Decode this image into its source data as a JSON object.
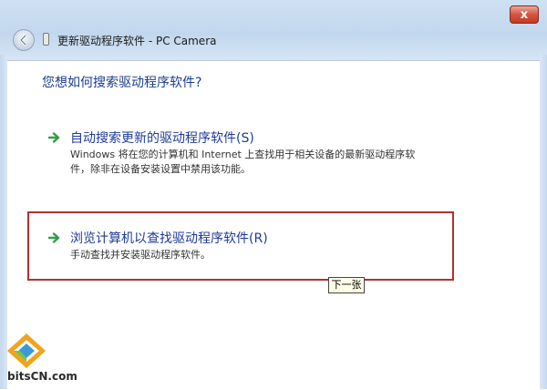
{
  "window": {
    "title": "更新驱动程序软件 - PC Camera",
    "close_label": "x"
  },
  "wizard": {
    "question": "您想如何搜索驱动程序软件?",
    "options": [
      {
        "title": "自动搜索更新的驱动程序软件(S)",
        "desc_line1": "Windows 将在您的计算机和 Internet 上查找用于相关设备的最新驱动程序软",
        "desc_line2": "件，除非在设备安装设置中禁用该功能。"
      },
      {
        "title": "浏览计算机以查找驱动程序软件(R)",
        "desc_line1": "手动查找并安装驱动程序软件。"
      }
    ]
  },
  "annotation": {
    "tooltip": "下一张"
  },
  "watermark": {
    "text": "bitsCN.com"
  },
  "colors": {
    "accent_link": "#1e3b9a",
    "arrow_green": "#2ea043",
    "highlight_red": "#b03030",
    "close_red": "#c23a25"
  },
  "icons": [
    "back-arrow-icon",
    "device-icon",
    "green-arrow-icon",
    "close-icon"
  ]
}
